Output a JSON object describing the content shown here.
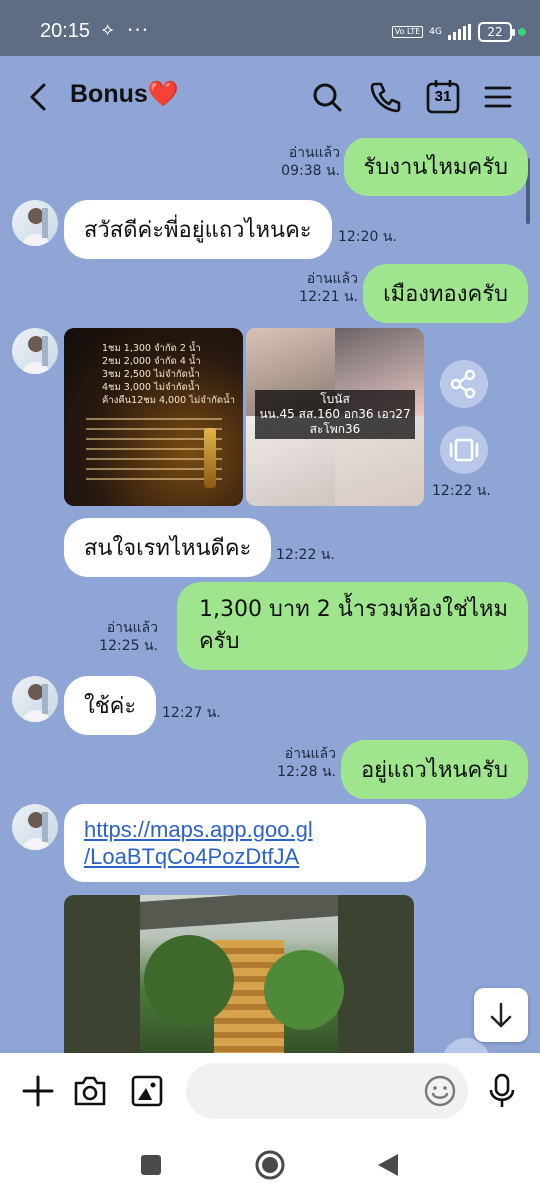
{
  "status_bar": {
    "time": "20:15",
    "extra_icon": "⟡",
    "dots": "···",
    "volte": "Vo LTE",
    "network": "4G",
    "battery": "22",
    "dot_color": "#3ad37a"
  },
  "header": {
    "title": "Bonus",
    "title_emoji": "❤️"
  },
  "messages": [
    {
      "dir": "out",
      "text": "รับงานไหมครับ",
      "read": "อ่านแล้ว",
      "time": "09:38 น."
    },
    {
      "dir": "in",
      "text": "สวัสดีค่ะพี่อยู่แถวไหนคะ",
      "time": "12:20 น."
    },
    {
      "dir": "out",
      "text": "เมืองทองครับ",
      "read": "อ่านแล้ว",
      "time": "12:21 น."
    },
    {
      "dir": "in",
      "type": "images",
      "time": "12:22 น.",
      "image_caption_lines": [
        "โบนัส",
        "นน.45 สส.160 อก36 เอว27",
        "สะโพก36"
      ],
      "price_list_lines": [
        "1ชม 1,300 จำกัด 2 น้ำ",
        "2ชม 2,000 จำกัด 4 น้ำ",
        "3ชม 2,500 ไม่จำกัดน้ำ",
        "4ชม 3,000 ไม่จำกัดน้ำ",
        "ค้างคืน12ชม 4,000 ไม่จำกัดน้ำ"
      ]
    },
    {
      "dir": "in",
      "text": "สนใจเรทไหนดีคะ",
      "time": "12:22 น."
    },
    {
      "dir": "out",
      "text_lines": [
        "1,300 บาท 2 น้ำรวมห้องใช่ไหม",
        "ครับ"
      ],
      "read": "อ่านแล้ว",
      "time": "12:25 น."
    },
    {
      "dir": "in",
      "text": "ใช้ค่ะ",
      "time": "12:27 น."
    },
    {
      "dir": "out",
      "text": "อยู่แถวไหนครับ",
      "read": "อ่านแล้ว",
      "time": "12:28 น."
    },
    {
      "dir": "in",
      "type": "link",
      "link_lines": [
        "https://maps.app.goo.gl",
        "/LoaBTqCo4PozDtfJA"
      ]
    }
  ],
  "colors": {
    "chat_bg": "#8ea5d6",
    "status_bg": "#5f6d84",
    "out_bubble": "#9fe58e",
    "in_bubble": "#ffffff",
    "link": "#2d63c6"
  },
  "icons": [
    "back-icon",
    "search-icon",
    "phone-icon",
    "calendar-icon",
    "menu-icon",
    "share-icon",
    "carousel-icon",
    "scroll-down-icon",
    "plus-icon",
    "camera-icon",
    "image-icon",
    "emoji-icon",
    "mic-icon"
  ],
  "calendar_day": "31"
}
